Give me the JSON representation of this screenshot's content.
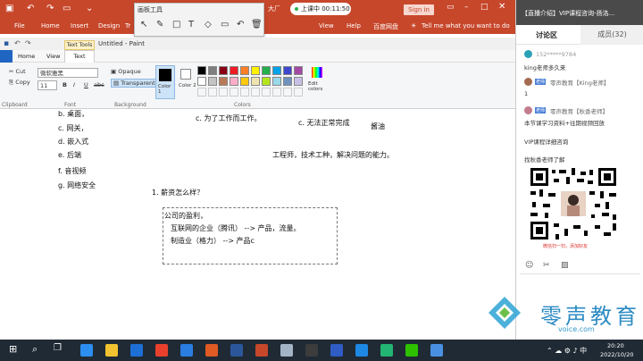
{
  "ppt": {
    "tabs": [
      "File",
      "Home",
      "Insert",
      "Design",
      "Tr",
      "View",
      "Help",
      "百度网盘"
    ],
    "tell_me": "Tell me what you want to do",
    "sign_in": "Sign in",
    "live_status": "上课中 00:11:50",
    "title_fragment": "大厂"
  },
  "pen_toolbar": {
    "title": "画板工具"
  },
  "paint": {
    "title": "Untitled - Paint",
    "text_tools": "Text Tools",
    "tabs": [
      "Home",
      "View",
      "Text"
    ],
    "clipboard": {
      "cut": "Cut",
      "copy": "Copy",
      "label": "Clipboard"
    },
    "font": {
      "name": "微软雅黑",
      "size": "11",
      "label": "Font"
    },
    "background": {
      "opaque": "Opaque",
      "transparent": "Transparent",
      "label": "Background"
    },
    "colors": {
      "color1": "Color 1",
      "color2": "Color 2",
      "label": "Colors",
      "edit": "Edit colors"
    },
    "swatches": [
      "#000000",
      "#7f7f7f",
      "#880015",
      "#ed1c24",
      "#ff7f27",
      "#fff200",
      "#22b14c",
      "#00a2e8",
      "#3f48cc",
      "#a349a4",
      "#ffffff",
      "#c3c3c3",
      "#b97a57",
      "#ffaec9",
      "#ffc90e",
      "#efe4b0",
      "#b5e61d",
      "#99d9ea",
      "#7092be",
      "#c8bfe7"
    ],
    "canvas": {
      "list_left": [
        "b. 桌面，",
        "c. 网关，",
        "d. 嵌入式",
        "e. 后端",
        "f. 音视频",
        "g. 网络安全"
      ],
      "mid_top": "c. 为了工作而工作。",
      "right_top": "c. 无法正常完成",
      "right_extra": "酱油",
      "engineer": "工程师，技术工种，解决问题的能力。",
      "question": "1. 薪资怎么样？",
      "box_lines": [
        "公司的盈利，",
        "互联网的企业（腾讯） --> 产品，流量。",
        "制造业（格力）       --> 产品c"
      ]
    }
  },
  "chat": {
    "header": "【直播介绍】VIP课程咨询-扬洛...",
    "tab_discussion": "讨论区",
    "tab_members": "成员(32)",
    "messages": [
      "152*****9784",
      "king老师多久来",
      "零声教育【King老师】",
      "1",
      "零声教育【秋香老师】",
      "本节课学习资料+往期视频回放",
      "VIP课程详细咨询",
      "找秋香老师了解"
    ],
    "badge_teacher": "老师",
    "qr_caption": "微信扫一扫，添加好友"
  },
  "taskbar": {
    "time": "20:20",
    "date": "2022/10/20"
  },
  "watermark": {
    "text": "零声教育",
    "domain": "voice.com"
  }
}
